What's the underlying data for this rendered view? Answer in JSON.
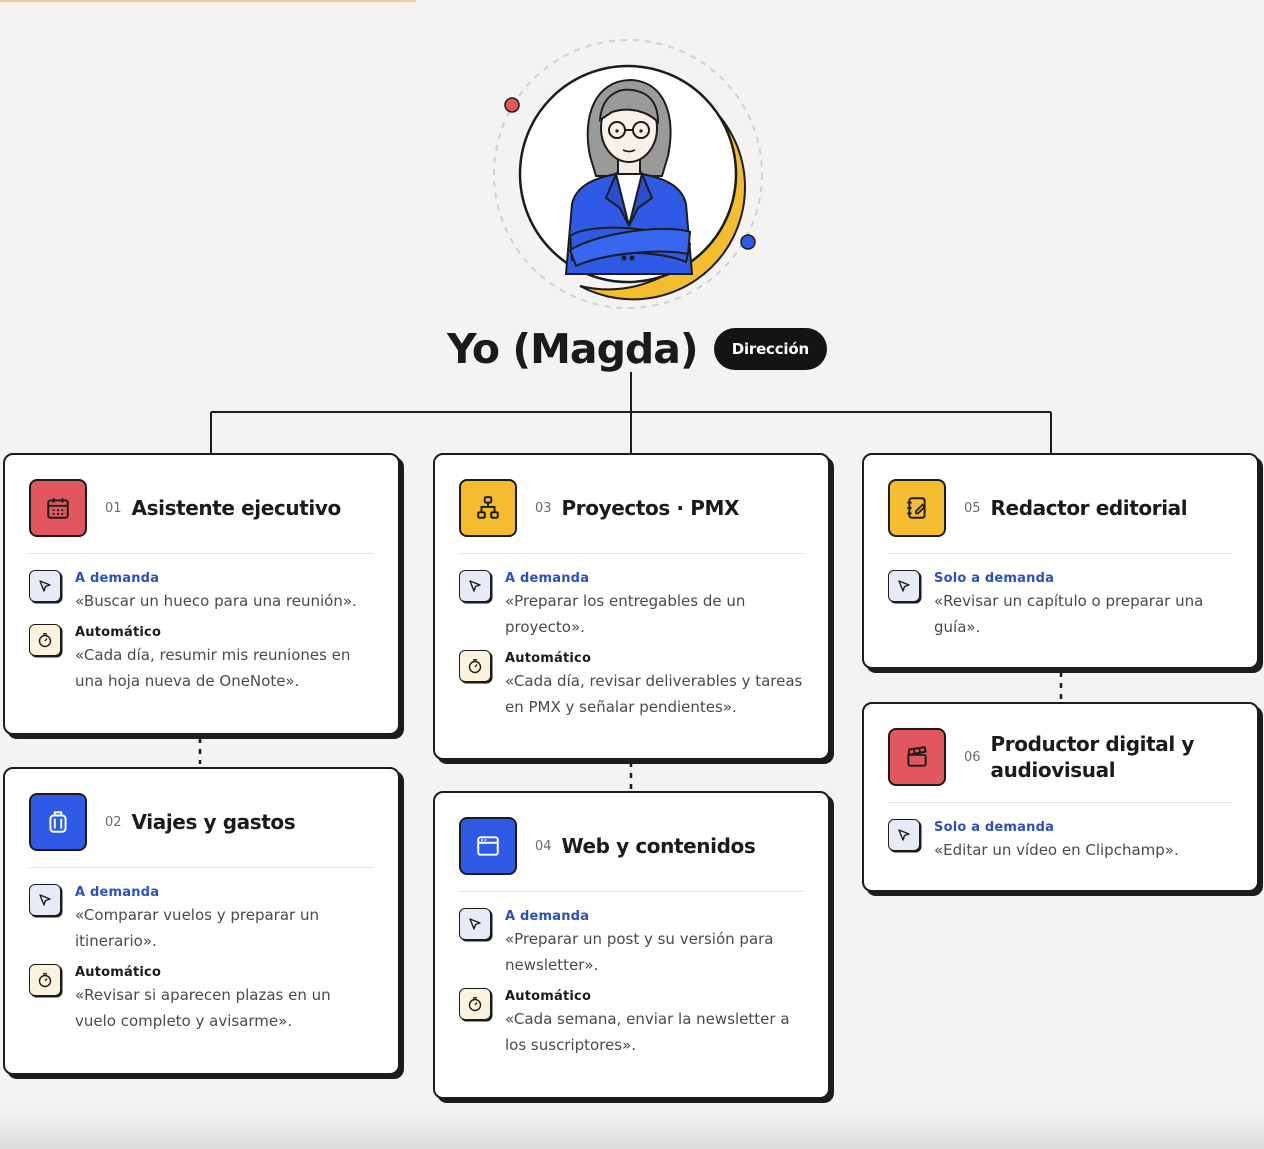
{
  "leader": {
    "name": "Yo (Magda)",
    "role": "Dirección"
  },
  "colors": {
    "red": "#e2565f",
    "yellow": "#f3bd2f",
    "blue": "#2f5ae6",
    "mode_blue": "#2b50c6"
  },
  "cards": [
    {
      "num": "01",
      "title": "Asistente ejecutivo",
      "icon": "calendar-icon",
      "icon_color": "#e2565f",
      "tasks": [
        {
          "mode": "A demanda",
          "icon": "pointer-icon",
          "text": "«Buscar un hueco para una reunión»."
        },
        {
          "mode": "Automático",
          "icon": "stopwatch-icon",
          "text": "«Cada día, resumir mis reuniones en una hoja nueva de OneNote»."
        }
      ]
    },
    {
      "num": "02",
      "title": "Viajes y gastos",
      "icon": "luggage-icon",
      "icon_color": "#2f5ae6",
      "tasks": [
        {
          "mode": "A demanda",
          "icon": "pointer-icon",
          "text": "«Comparar vuelos y preparar un itinerario»."
        },
        {
          "mode": "Automático",
          "icon": "stopwatch-icon",
          "text": "«Revisar si aparecen plazas en un vuelo completo y avisarme»."
        }
      ]
    },
    {
      "num": "03",
      "title": "Proyectos · PMX",
      "icon": "hierarchy-icon",
      "icon_color": "#f3bd2f",
      "tasks": [
        {
          "mode": "A demanda",
          "icon": "pointer-icon",
          "text": "«Preparar los entregables de un proyecto»."
        },
        {
          "mode": "Automático",
          "icon": "stopwatch-icon",
          "text": "«Cada día, revisar deliverables y tareas en PMX y señalar pendientes»."
        }
      ]
    },
    {
      "num": "04",
      "title": "Web y contenidos",
      "icon": "browser-window-icon",
      "icon_color": "#2f5ae6",
      "tasks": [
        {
          "mode": "A demanda",
          "icon": "pointer-icon",
          "text": "«Preparar un post y su versión para newsletter»."
        },
        {
          "mode": "Automático",
          "icon": "stopwatch-icon",
          "text": "«Cada semana, enviar la newsletter a los suscriptores»."
        }
      ]
    },
    {
      "num": "05",
      "title": "Redactor editorial",
      "icon": "notebook-pen-icon",
      "icon_color": "#f3bd2f",
      "tasks": [
        {
          "mode": "Solo a demanda",
          "icon": "pointer-icon",
          "text": "«Revisar un capítulo o preparar una guía»."
        }
      ]
    },
    {
      "num": "06",
      "title": "Productor digital y audiovisual",
      "icon": "clapperboard-icon",
      "icon_color": "#e2565f",
      "tasks": [
        {
          "mode": "Solo a demanda",
          "icon": "pointer-icon",
          "text": "«Editar un vídeo en Clipchamp»."
        }
      ]
    }
  ]
}
